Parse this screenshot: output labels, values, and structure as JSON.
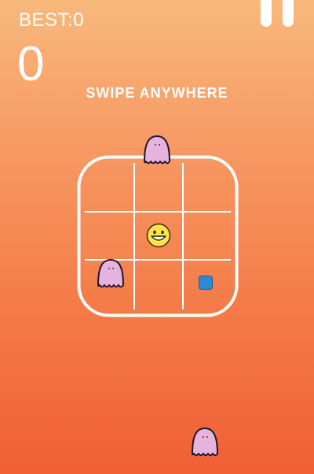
{
  "hud": {
    "best_label": "BEST:0",
    "score": "0",
    "hint": "SWIPE ANYWHERE"
  },
  "board": {
    "rows": 3,
    "cols": 3,
    "player_cell": [
      1,
      1
    ],
    "coin_cell": [
      2,
      2
    ],
    "ghosts_on_grid": [
      [
        2,
        0
      ]
    ]
  },
  "colors": {
    "background_top": "#f8b97c",
    "background_bottom": "#f05f36",
    "grid_line": "#ffffff",
    "ghost": "#e6b3dd",
    "player_face": "#fde44b",
    "coin": "#2a8ad2"
  },
  "icons": {
    "pause": "pause-icon",
    "ghost": "ghost-icon",
    "player": "smiley-face-icon",
    "coin": "blue-square-icon"
  }
}
